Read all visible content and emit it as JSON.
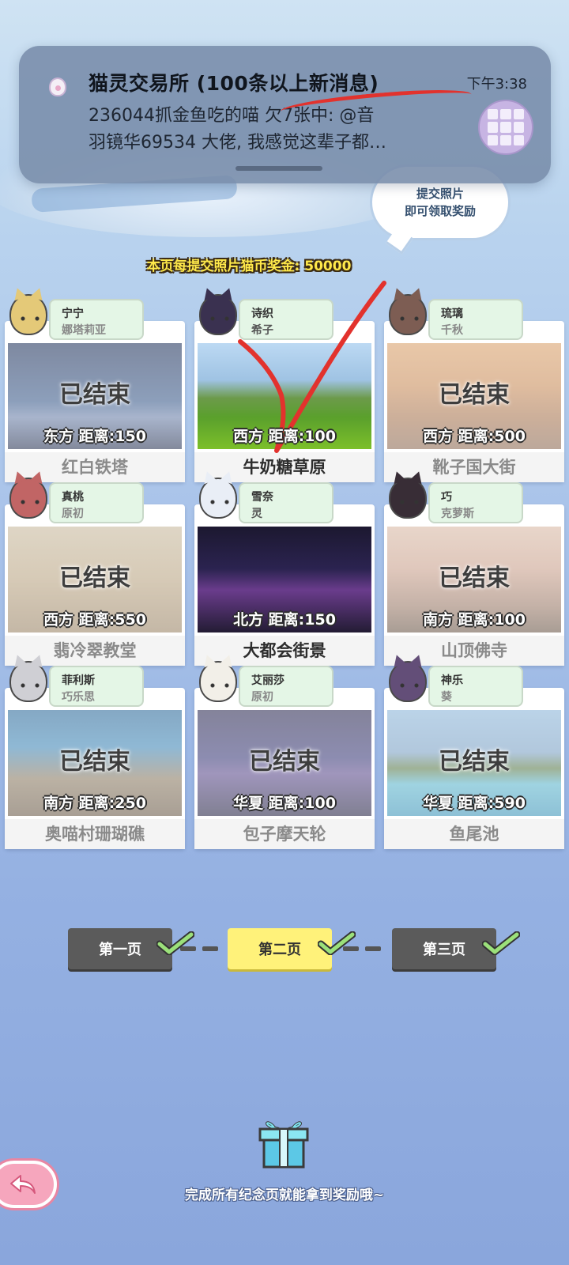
{
  "notification": {
    "title": "猫灵交易所 (100条以上新消息)",
    "time": "下午3:38",
    "line1": "236044抓金鱼吃的喵 欠7张中: @音",
    "line2": "羽镜华69534 大佬, 我感觉这辈子都…"
  },
  "hint_bubble": {
    "line1": "提交照片",
    "line2": "即可领取奖励"
  },
  "bonus_banner": "本页每提交照片猫币奖金: 50000",
  "ended_label": "已结束",
  "cards": [
    {
      "char_name": "宁宁",
      "char_sub": "娜塔莉亚",
      "direction_distance": "东方 距离:150",
      "place": "红白铁塔",
      "status": "ended",
      "chibi_color": "#f2c94c"
    },
    {
      "char_name": "诗织",
      "char_sub": "希子",
      "direction_distance": "西方 距离:100",
      "place": "牛奶糖草原",
      "status": "active",
      "chibi_color": "#3a3150"
    },
    {
      "char_name": "琉璃",
      "char_sub": "千秋",
      "direction_distance": "西方 距离:500",
      "place": "靴子国大街",
      "status": "ended",
      "chibi_color": "#8b5a4a"
    },
    {
      "char_name": "真桃",
      "char_sub": "原初",
      "direction_distance": "西方 距离:550",
      "place": "翡冷翠教堂",
      "status": "ended",
      "chibi_color": "#e85a5a"
    },
    {
      "char_name": "雪奈",
      "char_sub": "灵",
      "direction_distance": "北方 距离:150",
      "place": "大都会街景",
      "status": "active",
      "chibi_color": "#e9eef6"
    },
    {
      "char_name": "巧",
      "char_sub": "克萝斯",
      "direction_distance": "南方 距离:100",
      "place": "山顶佛寺",
      "status": "ended",
      "chibi_color": "#3d2b3a"
    },
    {
      "char_name": "菲利斯",
      "char_sub": "巧乐思",
      "direction_distance": "南方 距离:250",
      "place": "奥喵村珊瑚礁",
      "status": "ended",
      "chibi_color": "#cfcfd6"
    },
    {
      "char_name": "艾丽莎",
      "char_sub": "原初",
      "direction_distance": "华夏 距离:100",
      "place": "包子摩天轮",
      "status": "ended",
      "chibi_color": "#f4efe4"
    },
    {
      "char_name": "神乐",
      "char_sub": "葵",
      "direction_distance": "华夏 距离:590",
      "place": "鱼尾池",
      "status": "ended",
      "chibi_color": "#6a4a8a"
    }
  ],
  "pages": [
    {
      "label": "第一页",
      "completed": true,
      "current": false
    },
    {
      "label": "第二页",
      "completed": true,
      "current": true
    },
    {
      "label": "第三页",
      "completed": true,
      "current": false
    }
  ],
  "reward_text": "完成所有纪念页就能拿到奖励哦~",
  "icons": {
    "back": "back-arrow-icon",
    "gift": "gift-box-icon",
    "check": "check-icon"
  },
  "colors": {
    "check": "#9be07a",
    "current_page": "#fff27a",
    "annotation": "#e2322d"
  }
}
